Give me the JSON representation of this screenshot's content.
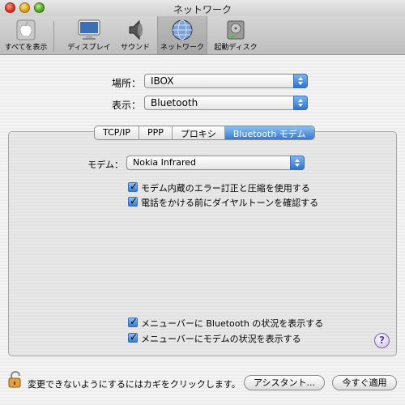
{
  "window": {
    "title": "ネットワーク"
  },
  "toolbar": {
    "items": [
      {
        "label": "すべてを表示",
        "icon": "apple-icon"
      },
      {
        "label": "ディスプレイ",
        "icon": "display-icon"
      },
      {
        "label": "サウンド",
        "icon": "speaker-icon"
      },
      {
        "label": "ネットワーク",
        "icon": "network-globe-icon"
      },
      {
        "label": "起動ディスク",
        "icon": "hard-disk-icon"
      }
    ],
    "selected": "ネットワーク"
  },
  "location": {
    "label": "場所：",
    "value": "IBOX"
  },
  "show": {
    "label": "表示：",
    "value": "Bluetooth"
  },
  "tabs": [
    "TCP/IP",
    "PPP",
    "プロキシ",
    "Bluetooth モデム"
  ],
  "active_tab": "Bluetooth モデム",
  "modem": {
    "label": "モデム：",
    "value": "Nokia Infrared"
  },
  "checkboxes": [
    {
      "label": "モデム内蔵のエラー訂正と圧縮を使用する",
      "checked": true
    },
    {
      "label": "電話をかける前にダイヤルトーンを確認する",
      "checked": true
    },
    {
      "label": "メニューバーに Bluetooth の状況を表示する",
      "checked": true
    },
    {
      "label": "メニューバーにモデムの状況を表示する",
      "checked": true
    }
  ],
  "help": {
    "label": "?"
  },
  "footer": {
    "lock_text": "変更できないようにするにはカギをクリックします。",
    "assistant_button": "アシスタント...",
    "apply_button": "今すぐ適用"
  },
  "colors": {
    "accent": "#3579d2",
    "window_bg": "#ececec"
  }
}
